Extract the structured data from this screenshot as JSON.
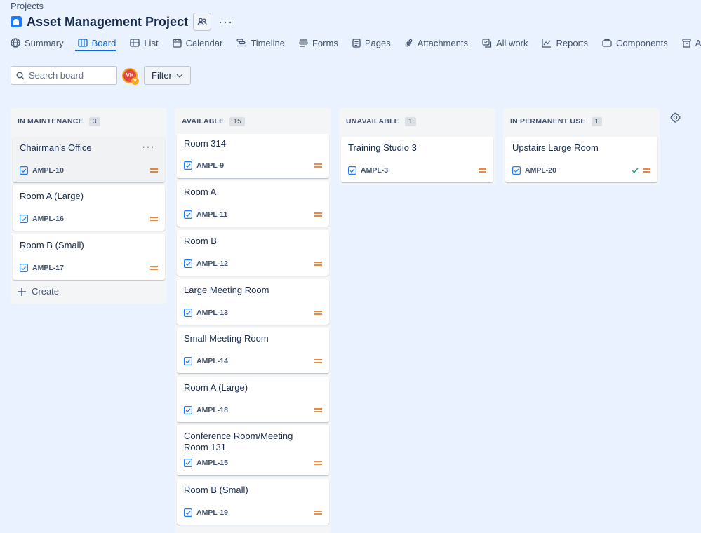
{
  "breadcrumb": "Projects",
  "project": {
    "title": "Asset Management Project"
  },
  "tabs": [
    {
      "label": "Summary",
      "icon": "globe-icon"
    },
    {
      "label": "Board",
      "icon": "board-icon"
    },
    {
      "label": "List",
      "icon": "list-icon"
    },
    {
      "label": "Calendar",
      "icon": "calendar-icon"
    },
    {
      "label": "Timeline",
      "icon": "timeline-icon"
    },
    {
      "label": "Forms",
      "icon": "forms-icon"
    },
    {
      "label": "Pages",
      "icon": "pages-icon"
    },
    {
      "label": "Attachments",
      "icon": "paperclip-icon"
    },
    {
      "label": "All work",
      "icon": "all-work-icon"
    },
    {
      "label": "Reports",
      "icon": "reports-icon"
    },
    {
      "label": "Components",
      "icon": "components-icon"
    },
    {
      "label": "Arch",
      "icon": "archive-icon"
    }
  ],
  "toolbar": {
    "search_placeholder": "Search board",
    "avatar_initials": "VH",
    "avatar_sub": "V",
    "filter_label": "Filter"
  },
  "columns": [
    {
      "title": "IN MAINTENANCE",
      "count": "3",
      "cards": [
        {
          "title": "Chairman's Office",
          "key": "AMPL-10"
        },
        {
          "title": "Room A (Large)",
          "key": "AMPL-16"
        },
        {
          "title": "Room B (Small)",
          "key": "AMPL-17"
        }
      ],
      "create_label": "Create"
    },
    {
      "title": "AVAILABLE",
      "count": "15",
      "cards": [
        {
          "title": "Room 314",
          "key": "AMPL-9"
        },
        {
          "title": "Room A",
          "key": "AMPL-11"
        },
        {
          "title": "Room B",
          "key": "AMPL-12"
        },
        {
          "title": "Large Meeting Room",
          "key": "AMPL-13"
        },
        {
          "title": "Small Meeting Room",
          "key": "AMPL-14"
        },
        {
          "title": "Room A (Large)",
          "key": "AMPL-18"
        },
        {
          "title": "Conference Room/Meeting Room 131",
          "key": "AMPL-15"
        },
        {
          "title": "Room B (Small)",
          "key": "AMPL-19"
        }
      ]
    },
    {
      "title": "UNAVAILABLE",
      "count": "1",
      "cards": [
        {
          "title": "Training Studio 3",
          "key": "AMPL-3"
        }
      ]
    },
    {
      "title": "IN PERMANENT USE",
      "count": "1",
      "cards": [
        {
          "title": "Upstairs Large Room",
          "key": "AMPL-20"
        }
      ]
    }
  ],
  "colors": {
    "accent": "#0c66e4",
    "priority_medium": "#e56910",
    "task_icon": "#1d7afc",
    "done_check": "#22a06b"
  }
}
